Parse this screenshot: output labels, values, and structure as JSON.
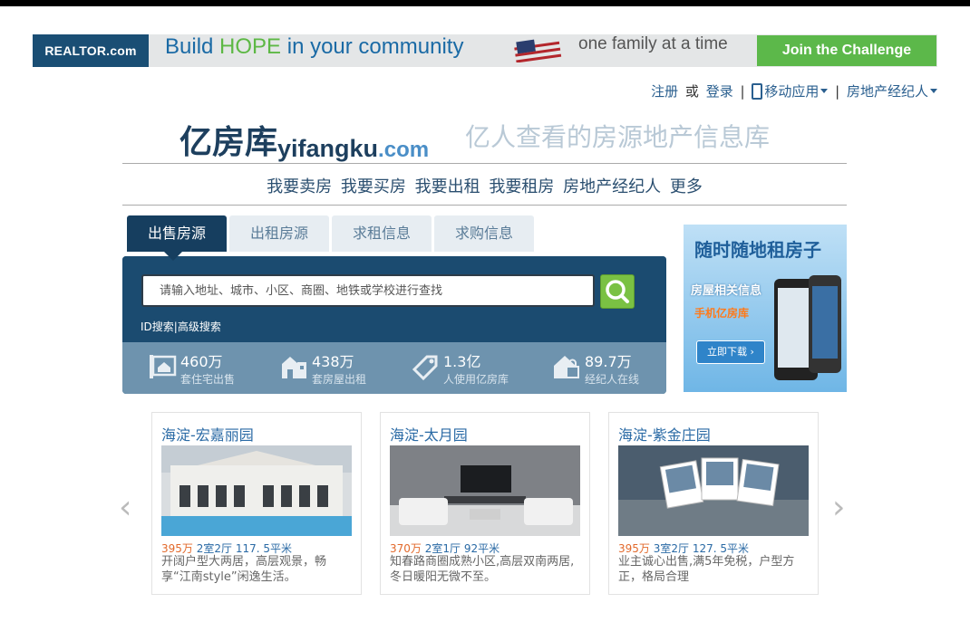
{
  "banner": {
    "realtor": "REALTOR.com",
    "hope_prefix": "Build ",
    "hope_word": "HOPE",
    "hope_suffix": " in your community",
    "family": "one family at a time",
    "challenge": "Join the Challenge"
  },
  "toplinks": {
    "register": "注册",
    "or": "或",
    "login": "登录",
    "mobile": "移动应用",
    "agent": "房地产经纪人"
  },
  "logo": {
    "cn": "亿房库",
    "en": "yifangku",
    "dom": ".com"
  },
  "slogan": "亿人查看的房源地产信息库",
  "nav": [
    "我要卖房",
    "我要买房",
    "我要出租",
    "我要租房",
    "房地产经纪人",
    "更多"
  ],
  "tabs": [
    "出售房源",
    "出租房源",
    "求租信息",
    "求购信息"
  ],
  "search": {
    "placeholder": "请输入地址、城市、小区、商圈、地铁或学校进行查找",
    "id_search": "ID搜索",
    "separator": "|",
    "adv_search": "高级搜索"
  },
  "stats": [
    {
      "value": "460万",
      "label": "套住宅出售",
      "icon": "house-sale-icon"
    },
    {
      "value": "438万",
      "label": "套房屋出租",
      "icon": "building-rent-icon"
    },
    {
      "value": "1.3亿",
      "label": "人使用亿房库",
      "icon": "tag-icon"
    },
    {
      "value": "89.7万",
      "label": "经纪人在线",
      "icon": "lock-house-icon"
    }
  ],
  "ad": {
    "headline": "随时随地租房子",
    "line1": "房屋相关信息",
    "line2": "手机亿房库",
    "download": "立即下载 ›"
  },
  "carousel": {
    "prev": "‹",
    "next": "›",
    "cards": [
      {
        "title": "海淀-宏嘉丽园",
        "price": "395万",
        "info": "2室2厅  117. 5平米",
        "desc": "开阔户型大两居，高层观景，畅享“江南style”闲逸生活。"
      },
      {
        "title": "海淀-太月园",
        "price": "370万",
        "info": "2室1厅  92平米",
        "desc": "知春路商圈成熟小区,高层双南两居,冬日暖阳无微不至。"
      },
      {
        "title": "海淀-紫金庄园",
        "price": "395万",
        "info": "3室2厅  127. 5平米",
        "desc": "业主诚心出售,满5年免税，户型方正，格局合理"
      }
    ]
  },
  "colors": {
    "brand_dark": "#163e5f",
    "search_bg": "#1b4b70",
    "stats_bg": "#6e93ae",
    "link": "#2a6aa5",
    "price": "#e2692b",
    "go_green": "#7ac143",
    "challenge_green": "#5cb84a"
  }
}
